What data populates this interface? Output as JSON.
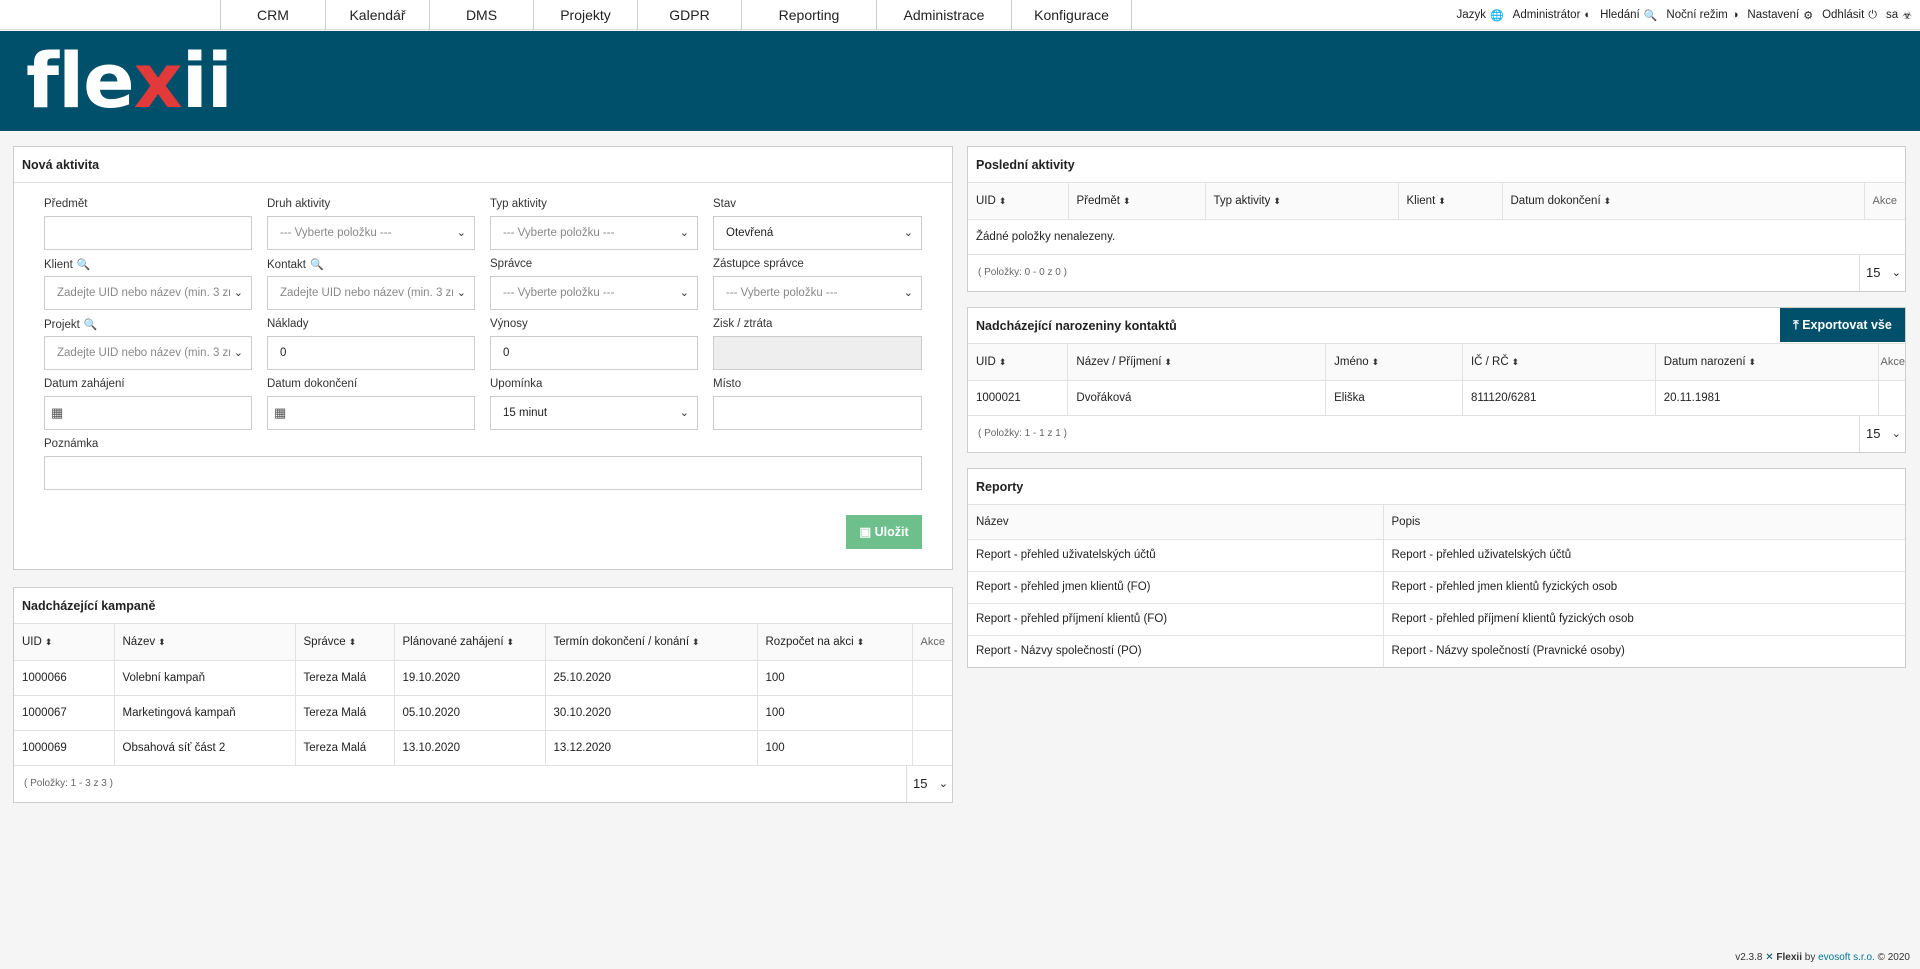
{
  "nav": {
    "items": [
      {
        "label": "CRM",
        "width": 105
      },
      {
        "label": "Kalendář",
        "width": 104
      },
      {
        "label": "DMS",
        "width": 104
      },
      {
        "label": "Projekty",
        "width": 104
      },
      {
        "label": "GDPR",
        "width": 104
      },
      {
        "label": "Reporting",
        "width": 135
      },
      {
        "label": "Administrace",
        "width": 135
      },
      {
        "label": "Konfigurace",
        "width": 120
      }
    ],
    "user_items": {
      "language": "Jazyk",
      "admin": "Administrátor",
      "search": "Hledání",
      "night": "Noční režim",
      "settings": "Nastavení",
      "logout": "Odhlásit",
      "user": "sa"
    }
  },
  "brand": {
    "logo_prefix": "fle",
    "logo_x": "x",
    "logo_suffix": "ii"
  },
  "new_activity": {
    "title": "Nová aktivita",
    "subject_label": "Předmět",
    "subject_value": "",
    "kind_label": "Druh aktivity",
    "kind_value": "--- Vyberte položku ---",
    "type_label": "Typ aktivity",
    "type_value": "--- Vyberte položku ---",
    "state_label": "Stav",
    "state_value": "Otevřená",
    "client_label": "Klient",
    "client_placeholder": "Zadejte UID nebo název (min. 3 zn",
    "contact_label": "Kontakt",
    "contact_placeholder": "Zadejte UID nebo název (min. 3 zn",
    "manager_label": "Správce",
    "manager_value": "--- Vyberte položku ---",
    "deputy_label": "Zástupce správce",
    "deputy_value": "--- Vyberte položku ---",
    "project_label": "Projekt",
    "project_placeholder": "Zadejte UID nebo název (min. 3 zn",
    "costs_label": "Náklady",
    "costs_value": "0",
    "revenue_label": "Výnosy",
    "revenue_value": "0",
    "profit_label": "Zisk / ztráta",
    "profit_value": "",
    "start_label": "Datum zahájení",
    "start_value": "",
    "end_label": "Datum dokončení",
    "end_value": "",
    "reminder_label": "Upomínka",
    "reminder_value": "15 minut",
    "place_label": "Místo",
    "place_value": "",
    "note_label": "Poznámka",
    "note_value": "",
    "save_label": "Uložit"
  },
  "campaigns": {
    "title": "Nadcházející kampaně",
    "columns": [
      "UID",
      "Název",
      "Správce",
      "Plánované zahájení",
      "Termín dokončení / konání",
      "Rozpočet na akci",
      "Akce"
    ],
    "rows": [
      [
        "1000066",
        "Volební kampaň",
        "Tereza Malá",
        "19.10.2020",
        "25.10.2020",
        "100",
        ""
      ],
      [
        "1000067",
        "Marketingová kampaň",
        "Tereza Malá",
        "05.10.2020",
        "30.10.2020",
        "100",
        ""
      ],
      [
        "1000069",
        "Obsahová síť část 2",
        "Tereza Malá",
        "13.10.2020",
        "13.12.2020",
        "100",
        ""
      ]
    ],
    "count": "( Položky: 1 - 3 z 3 )",
    "page_size": "15"
  },
  "recent": {
    "title": "Poslední aktivity",
    "columns": [
      "UID",
      "Předmět",
      "Typ aktivity",
      "Klient",
      "Datum dokončení",
      "Akce"
    ],
    "empty": "Žádné položky nenalezeny.",
    "count": "( Položky: 0 - 0 z 0 )",
    "page_size": "15"
  },
  "birthdays": {
    "title": "Nadcházející narozeniny kontaktů",
    "export_label": "Exportovat vše",
    "columns": [
      "UID",
      "Název / Příjmení",
      "Jméno",
      "IČ / RČ",
      "Datum narození",
      "Akce"
    ],
    "rows": [
      [
        "1000021",
        "Dvořáková",
        "Eliška",
        "811120/6281",
        "20.11.1981",
        ""
      ]
    ],
    "count": "( Položky: 1 - 1 z 1 )",
    "page_size": "15"
  },
  "reports": {
    "title": "Reporty",
    "columns": [
      "Název",
      "Popis"
    ],
    "rows": [
      [
        "Report - přehled uživatelských účtů",
        "Report - přehled uživatelských účtů"
      ],
      [
        "Report - přehled jmen klientů (FO)",
        "Report - přehled jmen klientů fyzických osob"
      ],
      [
        "Report - přehled příjmení klientů (FO)",
        "Report - přehled příjmení klientů fyzických osob"
      ],
      [
        "Report - Názvy společností (PO)",
        "Report - Názvy společností (Pravnické osoby)"
      ]
    ]
  },
  "footer": {
    "version": "v2.3.8",
    "brand": "Flexii",
    "by": "by",
    "company": "evosoft s.r.o.",
    "copyright": "© 2020"
  }
}
